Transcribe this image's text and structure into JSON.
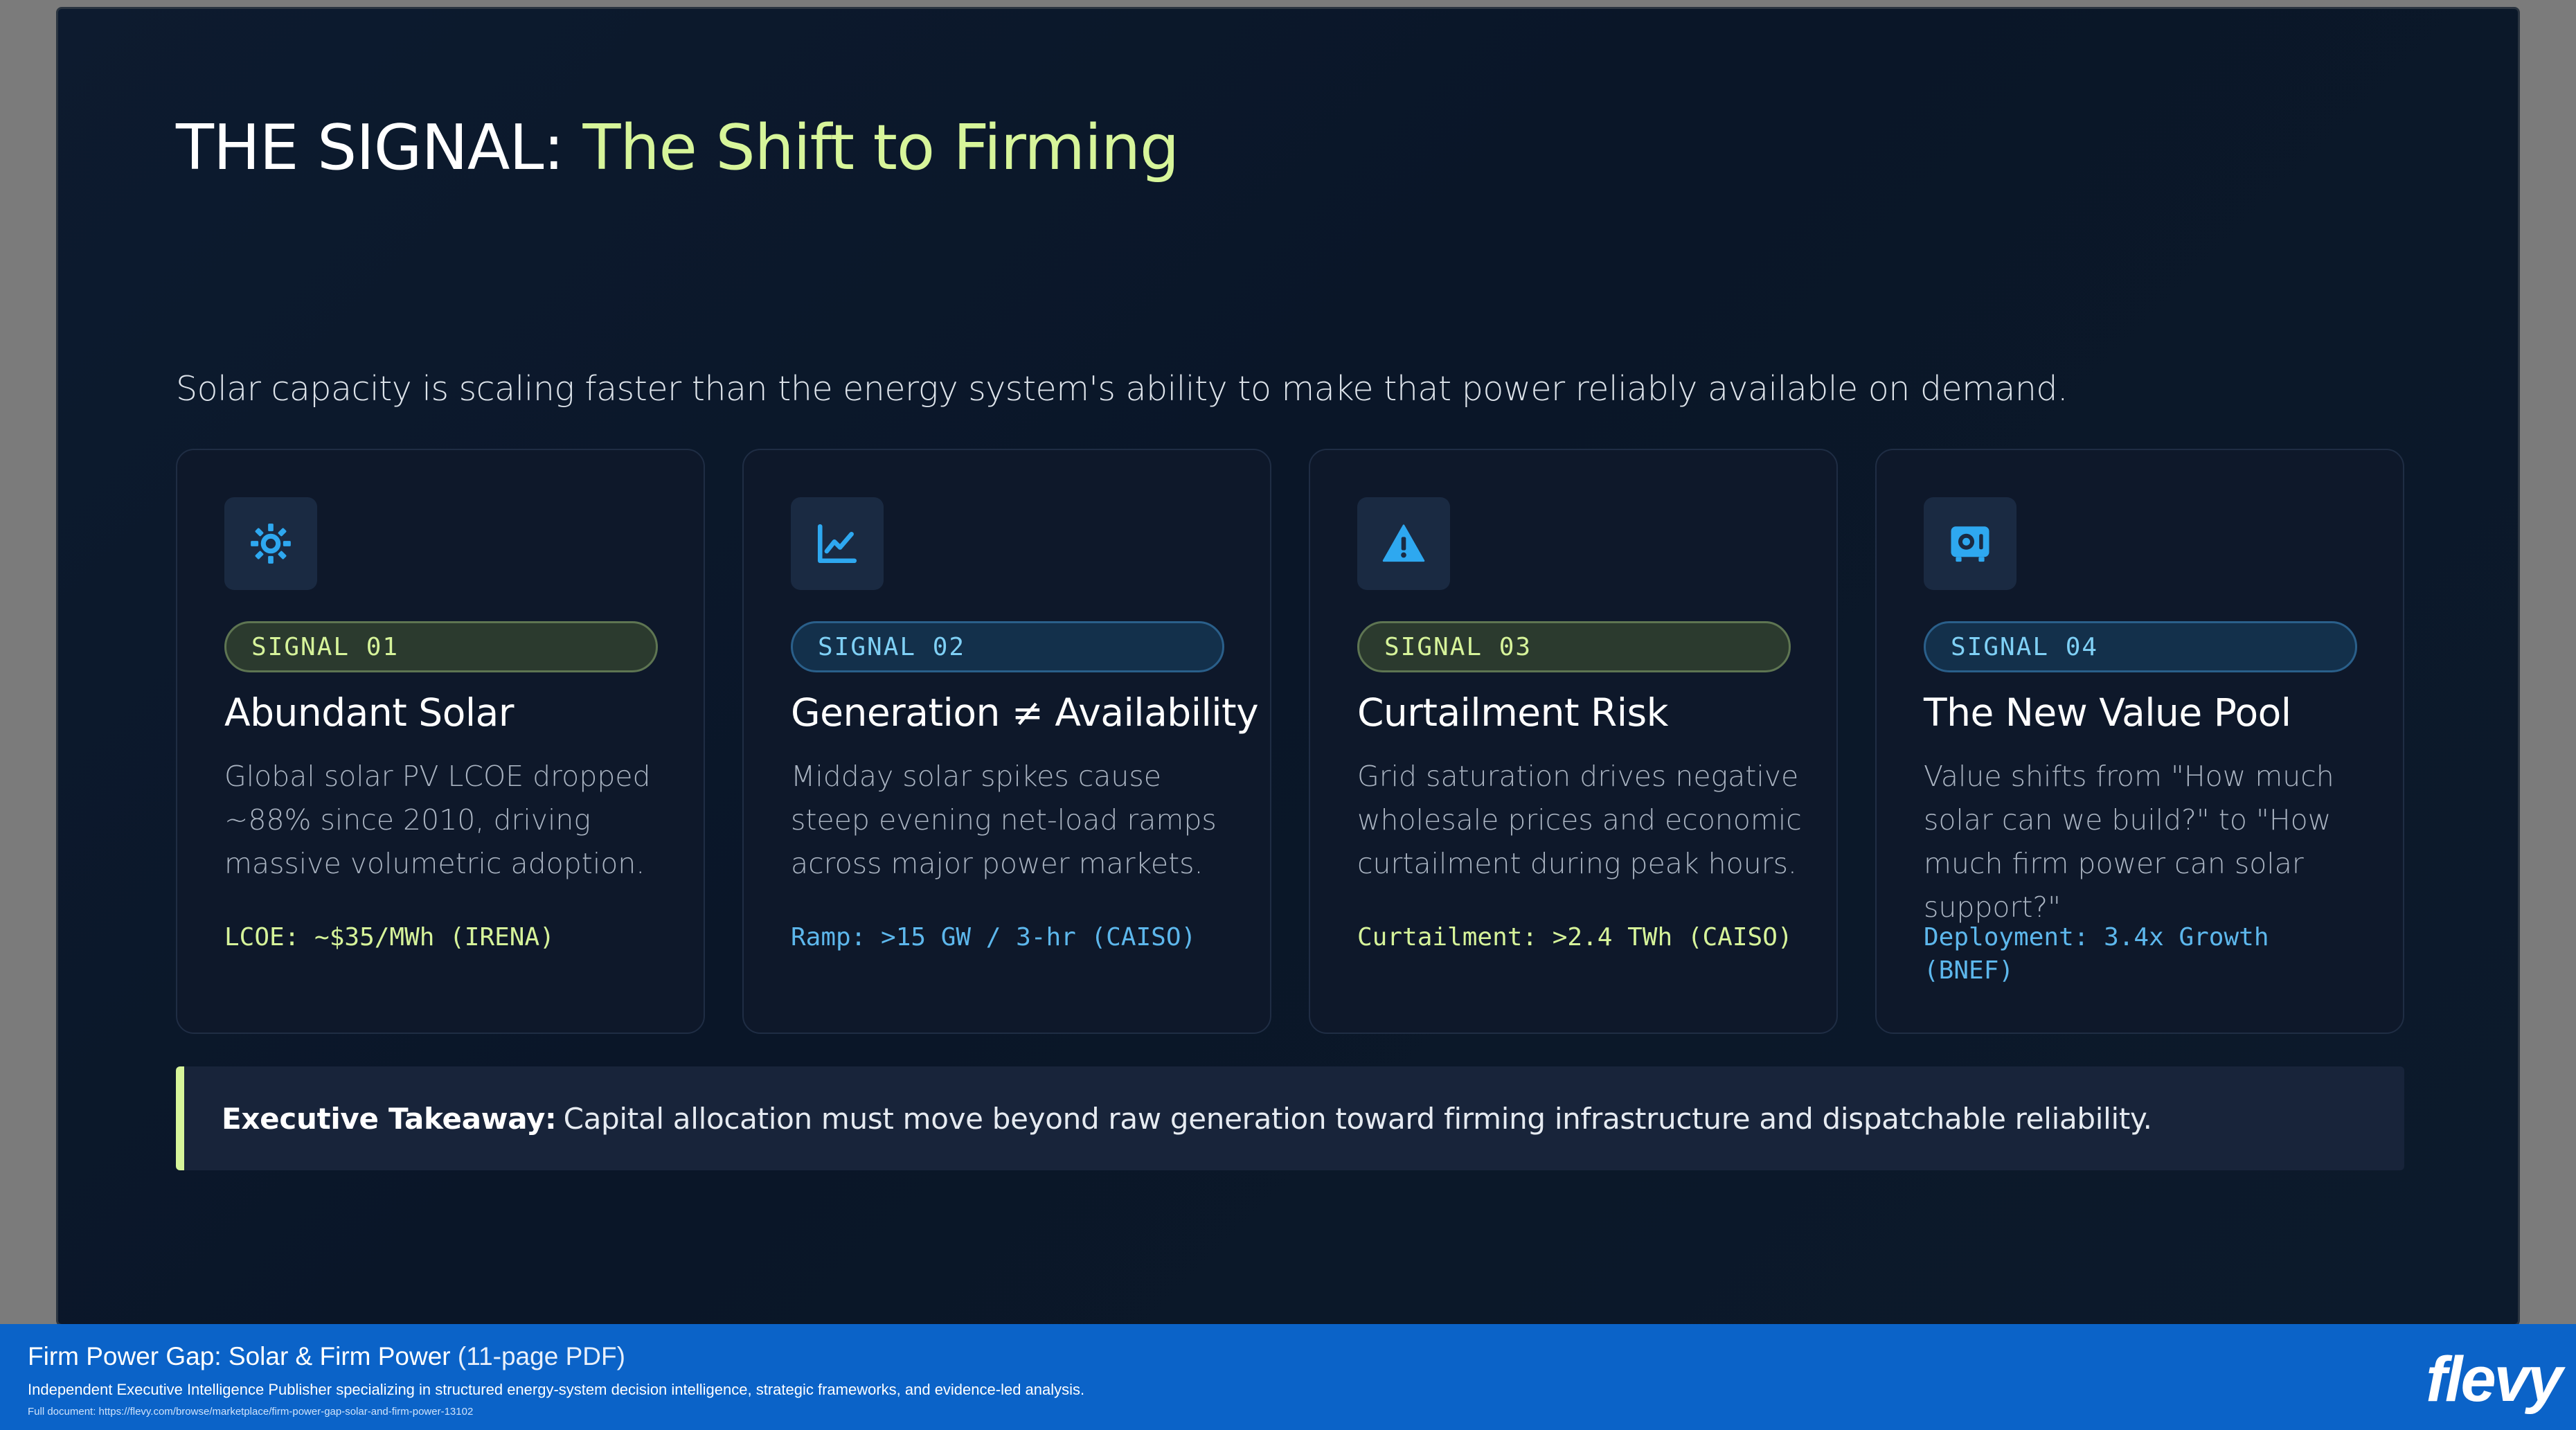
{
  "slide": {
    "title_prefix": "THE SIGNAL:",
    "title_highlight": "The Shift to Firming",
    "subtitle": "Solar capacity is scaling faster than the energy system's ability to make that power reliably available on demand."
  },
  "cards": [
    {
      "icon": "sun-gear-icon",
      "tag": "SIGNAL 01",
      "title": "Abundant Solar",
      "description": "Global solar PV LCOE dropped ~88% since 2010, driving massive volumetric adoption.",
      "metric": "LCOE: ~$35/MWh (IRENA)",
      "accent": "green"
    },
    {
      "icon": "line-chart-icon",
      "tag": "SIGNAL 02",
      "title": "Generation ≠ Availability",
      "description": "Midday solar spikes cause steep evening net-load ramps across major power markets.",
      "metric": "Ramp: >15 GW / 3-hr (CAISO)",
      "accent": "blue"
    },
    {
      "icon": "warning-triangle-icon",
      "tag": "SIGNAL 03",
      "title": "Curtailment Risk",
      "description": "Grid saturation drives negative wholesale prices and economic curtailment during peak hours.",
      "metric": "Curtailment: >2.4 TWh (CAISO)",
      "accent": "green"
    },
    {
      "icon": "vault-icon",
      "tag": "SIGNAL 04",
      "title": "The New Value Pool",
      "description": "Value shifts from \"How much solar can we build?\" to \"How much firm power can solar support?\"",
      "metric": "Deployment: 3.4x Growth (BNEF)",
      "accent": "blue"
    }
  ],
  "takeaway": {
    "label": "Executive Takeaway:",
    "text": "Capital allocation must move beyond raw generation toward firming infrastructure and dispatchable reliability."
  },
  "footer": {
    "title": "Firm Power Gap: Solar & Firm Power",
    "title_suffix": "(11-page PDF)",
    "description": "Independent Executive Intelligence Publisher specializing in structured energy-system decision intelligence, strategic frameworks, and evidence-led analysis.",
    "link": "Full document: https://flevy.com/browse/marketplace/firm-power-gap-solar-and-firm-power-13102",
    "brand": "flevy"
  },
  "colors": {
    "accent_green": "#d7f59a",
    "accent_blue": "#5db7ec",
    "icon_blue": "#2ea8f0",
    "footer_blue": "#0b63c8"
  }
}
